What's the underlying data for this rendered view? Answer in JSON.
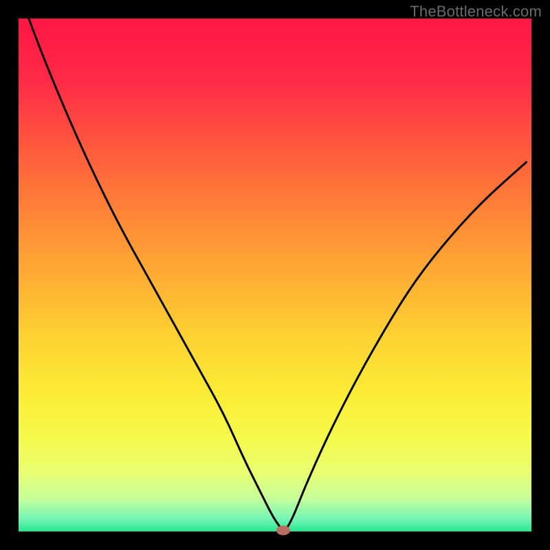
{
  "watermark": "TheBottleneck.com",
  "chart_data": {
    "type": "line",
    "title": "",
    "xlabel": "",
    "ylabel": "",
    "xlim": [
      0,
      100
    ],
    "ylim": [
      0,
      100
    ],
    "grid": false,
    "notes": "V-shaped bottleneck curve over a rainbow (red→orange→yellow→green) vertical gradient background. Axes are unlabeled; values are approximate positions on a 0–100 scale.",
    "series": [
      {
        "name": "bottleneck-curve",
        "x": [
          2,
          5,
          10,
          15,
          20,
          25,
          30,
          35,
          40,
          44,
          47,
          49.5,
          51,
          51.6,
          52.2,
          53,
          54,
          56,
          60,
          65,
          70,
          76,
          82,
          90,
          99
        ],
        "values": [
          100,
          92,
          80,
          69,
          59,
          50,
          41,
          32,
          23,
          14,
          8,
          3,
          0.8,
          0.2,
          0.5,
          1.8,
          4,
          9,
          18,
          28,
          37,
          47,
          55,
          64,
          72
        ]
      }
    ],
    "marker": {
      "name": "min-point",
      "x": 51.6,
      "y": 0.2,
      "color": "#bb6e63"
    },
    "gradient_stops": [
      {
        "offset": 0.0,
        "color": "#ff1744"
      },
      {
        "offset": 0.12,
        "color": "#ff2a47"
      },
      {
        "offset": 0.3,
        "color": "#ff6a3a"
      },
      {
        "offset": 0.48,
        "color": "#ffa634"
      },
      {
        "offset": 0.62,
        "color": "#fed232"
      },
      {
        "offset": 0.74,
        "color": "#fbee37"
      },
      {
        "offset": 0.82,
        "color": "#f5fa4c"
      },
      {
        "offset": 0.885,
        "color": "#eaff71"
      },
      {
        "offset": 0.935,
        "color": "#c7ff9a"
      },
      {
        "offset": 0.975,
        "color": "#74f6b4"
      },
      {
        "offset": 1.0,
        "color": "#2ae590"
      }
    ],
    "frame_color": "#000000",
    "frame_width_ratio": 0.034
  }
}
